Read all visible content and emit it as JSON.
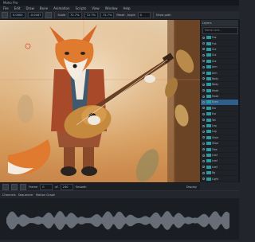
{
  "app": {
    "title": "Moho Pro"
  },
  "menu": [
    "File",
    "Edit",
    "Draw",
    "Bone",
    "Animation",
    "Scripts",
    "View",
    "Window",
    "Help"
  ],
  "toolbar": {
    "field1": "0.0000",
    "field2": "-0.0447",
    "label_scale": "Scale",
    "field_scale_x": "72.7%",
    "field_scale_y": "72.7%",
    "field_scale_z": "72.7%",
    "label_reset": "Reset",
    "label_angle": "Angle",
    "field_angle": "0",
    "show_path": "Show path"
  },
  "bottom_toolbar": {
    "frame_label": "Frame",
    "frame_value": "0",
    "of_label": "of",
    "of_value": "240",
    "secondary_label": "Smooth",
    "display_label": "Display"
  },
  "layers_panel": {
    "tab": "Layers",
    "filter_placeholder": "Name cont...",
    "rows": [
      {
        "name": "Fox"
      },
      {
        "name": "Fox"
      },
      {
        "name": "Gui"
      },
      {
        "name": "Gui"
      },
      {
        "name": "Gui"
      },
      {
        "name": "Arm"
      },
      {
        "name": "Arm"
      },
      {
        "name": "Body"
      },
      {
        "name": "Body"
      },
      {
        "name": "Head"
      },
      {
        "name": "Head"
      },
      {
        "name": "Eyes"
      },
      {
        "name": "Ear"
      },
      {
        "name": "Ear"
      },
      {
        "name": "Tail"
      },
      {
        "name": "Leg"
      },
      {
        "name": "Leg"
      },
      {
        "name": "Shoe"
      },
      {
        "name": "Shoe"
      },
      {
        "name": "Tree"
      },
      {
        "name": "Leaf"
      },
      {
        "name": "Leaf"
      },
      {
        "name": "Leaf"
      },
      {
        "name": "Bg"
      },
      {
        "name": "Light"
      },
      {
        "name": "Light"
      },
      {
        "name": "Sky"
      },
      {
        "name": "Sky"
      }
    ]
  },
  "timeline": {
    "channels_label": "Channels",
    "sequencer_label": "Sequencer",
    "motion_label": "Motion Graph"
  }
}
